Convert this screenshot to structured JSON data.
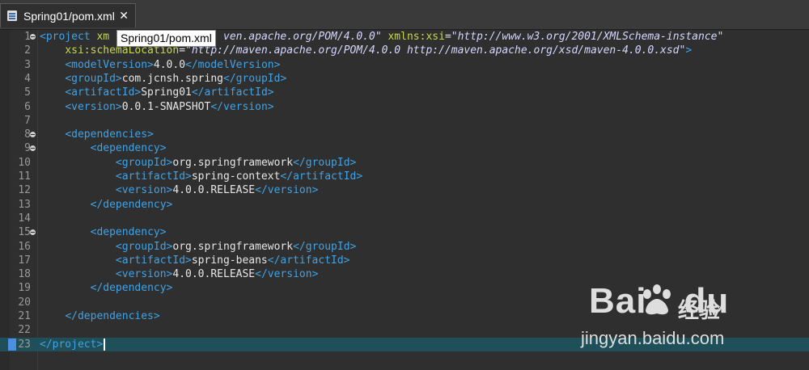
{
  "tab": {
    "title": "Spring01/pom.xml",
    "close": "✕"
  },
  "tooltip": {
    "text": "Spring01/pom.xml"
  },
  "colors": {
    "tag": "#3fa3e8",
    "attr": "#c8d850",
    "value": "#d6d6ff",
    "text": "#e6e6e6",
    "current_line": "#1f4f58"
  },
  "lines": [
    {
      "n": "1",
      "fold": true,
      "segs": [
        {
          "k": "tag",
          "t": "<project "
        },
        {
          "k": "attr",
          "t": "xm"
        },
        {
          "k": "val",
          "t": "                  ven.apache.org/POM/4.0.0\""
        },
        {
          "k": "txt",
          "t": " "
        },
        {
          "k": "attr",
          "t": "xmlns:xsi"
        },
        {
          "k": "txt",
          "t": "="
        },
        {
          "k": "val",
          "t": "\"http://www.w3.org/2001/XMLSchema-instance\""
        }
      ]
    },
    {
      "n": "2",
      "segs": [
        {
          "k": "txt",
          "t": "    "
        },
        {
          "k": "attr",
          "t": "xsi:schemaLocation"
        },
        {
          "k": "txt",
          "t": "="
        },
        {
          "k": "val",
          "t": "\"http://maven.apache.org/POM/4.0.0 http://maven.apache.org/xsd/maven-4.0.0.xsd\""
        },
        {
          "k": "tag",
          "t": ">"
        }
      ]
    },
    {
      "n": "3",
      "segs": [
        {
          "k": "txt",
          "t": "    "
        },
        {
          "k": "tag",
          "t": "<modelVersion>"
        },
        {
          "k": "txt",
          "t": "4.0.0"
        },
        {
          "k": "tag",
          "t": "</modelVersion>"
        }
      ]
    },
    {
      "n": "4",
      "segs": [
        {
          "k": "txt",
          "t": "    "
        },
        {
          "k": "tag",
          "t": "<groupId>"
        },
        {
          "k": "txt",
          "t": "com.jcnsh.spring"
        },
        {
          "k": "tag",
          "t": "</groupId>"
        }
      ]
    },
    {
      "n": "5",
      "segs": [
        {
          "k": "txt",
          "t": "    "
        },
        {
          "k": "tag",
          "t": "<artifactId>"
        },
        {
          "k": "txt",
          "t": "Spring01"
        },
        {
          "k": "tag",
          "t": "</artifactId>"
        }
      ]
    },
    {
      "n": "6",
      "segs": [
        {
          "k": "txt",
          "t": "    "
        },
        {
          "k": "tag",
          "t": "<version>"
        },
        {
          "k": "txt",
          "t": "0.0.1-SNAPSHOT"
        },
        {
          "k": "tag",
          "t": "</version>"
        }
      ]
    },
    {
      "n": "7",
      "segs": []
    },
    {
      "n": "8",
      "fold": true,
      "segs": [
        {
          "k": "txt",
          "t": "    "
        },
        {
          "k": "tag",
          "t": "<dependencies>"
        }
      ]
    },
    {
      "n": "9",
      "fold": true,
      "segs": [
        {
          "k": "txt",
          "t": "        "
        },
        {
          "k": "tag",
          "t": "<dependency>"
        }
      ]
    },
    {
      "n": "10",
      "segs": [
        {
          "k": "txt",
          "t": "            "
        },
        {
          "k": "tag",
          "t": "<groupId>"
        },
        {
          "k": "txt",
          "t": "org.springframework"
        },
        {
          "k": "tag",
          "t": "</groupId>"
        }
      ]
    },
    {
      "n": "11",
      "segs": [
        {
          "k": "txt",
          "t": "            "
        },
        {
          "k": "tag",
          "t": "<artifactId>"
        },
        {
          "k": "txt",
          "t": "spring-context"
        },
        {
          "k": "tag",
          "t": "</artifactId>"
        }
      ]
    },
    {
      "n": "12",
      "segs": [
        {
          "k": "txt",
          "t": "            "
        },
        {
          "k": "tag",
          "t": "<version>"
        },
        {
          "k": "txt",
          "t": "4.0.0.RELEASE"
        },
        {
          "k": "tag",
          "t": "</version>"
        }
      ]
    },
    {
      "n": "13",
      "segs": [
        {
          "k": "txt",
          "t": "        "
        },
        {
          "k": "tag",
          "t": "</dependency>"
        }
      ]
    },
    {
      "n": "14",
      "segs": []
    },
    {
      "n": "15",
      "fold": true,
      "segs": [
        {
          "k": "txt",
          "t": "        "
        },
        {
          "k": "tag",
          "t": "<dependency>"
        }
      ]
    },
    {
      "n": "16",
      "segs": [
        {
          "k": "txt",
          "t": "            "
        },
        {
          "k": "tag",
          "t": "<groupId>"
        },
        {
          "k": "txt",
          "t": "org.springframework"
        },
        {
          "k": "tag",
          "t": "</groupId>"
        }
      ]
    },
    {
      "n": "17",
      "segs": [
        {
          "k": "txt",
          "t": "            "
        },
        {
          "k": "tag",
          "t": "<artifactId>"
        },
        {
          "k": "txt",
          "t": "spring-beans"
        },
        {
          "k": "tag",
          "t": "</artifactId>"
        }
      ]
    },
    {
      "n": "18",
      "segs": [
        {
          "k": "txt",
          "t": "            "
        },
        {
          "k": "tag",
          "t": "<version>"
        },
        {
          "k": "txt",
          "t": "4.0.0.RELEASE"
        },
        {
          "k": "tag",
          "t": "</version>"
        }
      ]
    },
    {
      "n": "19",
      "segs": [
        {
          "k": "txt",
          "t": "        "
        },
        {
          "k": "tag",
          "t": "</dependency>"
        }
      ]
    },
    {
      "n": "20",
      "segs": []
    },
    {
      "n": "21",
      "segs": [
        {
          "k": "txt",
          "t": "    "
        },
        {
          "k": "tag",
          "t": "</dependencies>"
        }
      ]
    },
    {
      "n": "22",
      "segs": []
    },
    {
      "n": "23",
      "current": true,
      "segs": [
        {
          "k": "tag",
          "t": "</project>"
        }
      ]
    }
  ],
  "watermark": {
    "brand": "Bai",
    "brand2": "du",
    "jingyan": "经验",
    "url": "jingyan.baidu.com"
  }
}
